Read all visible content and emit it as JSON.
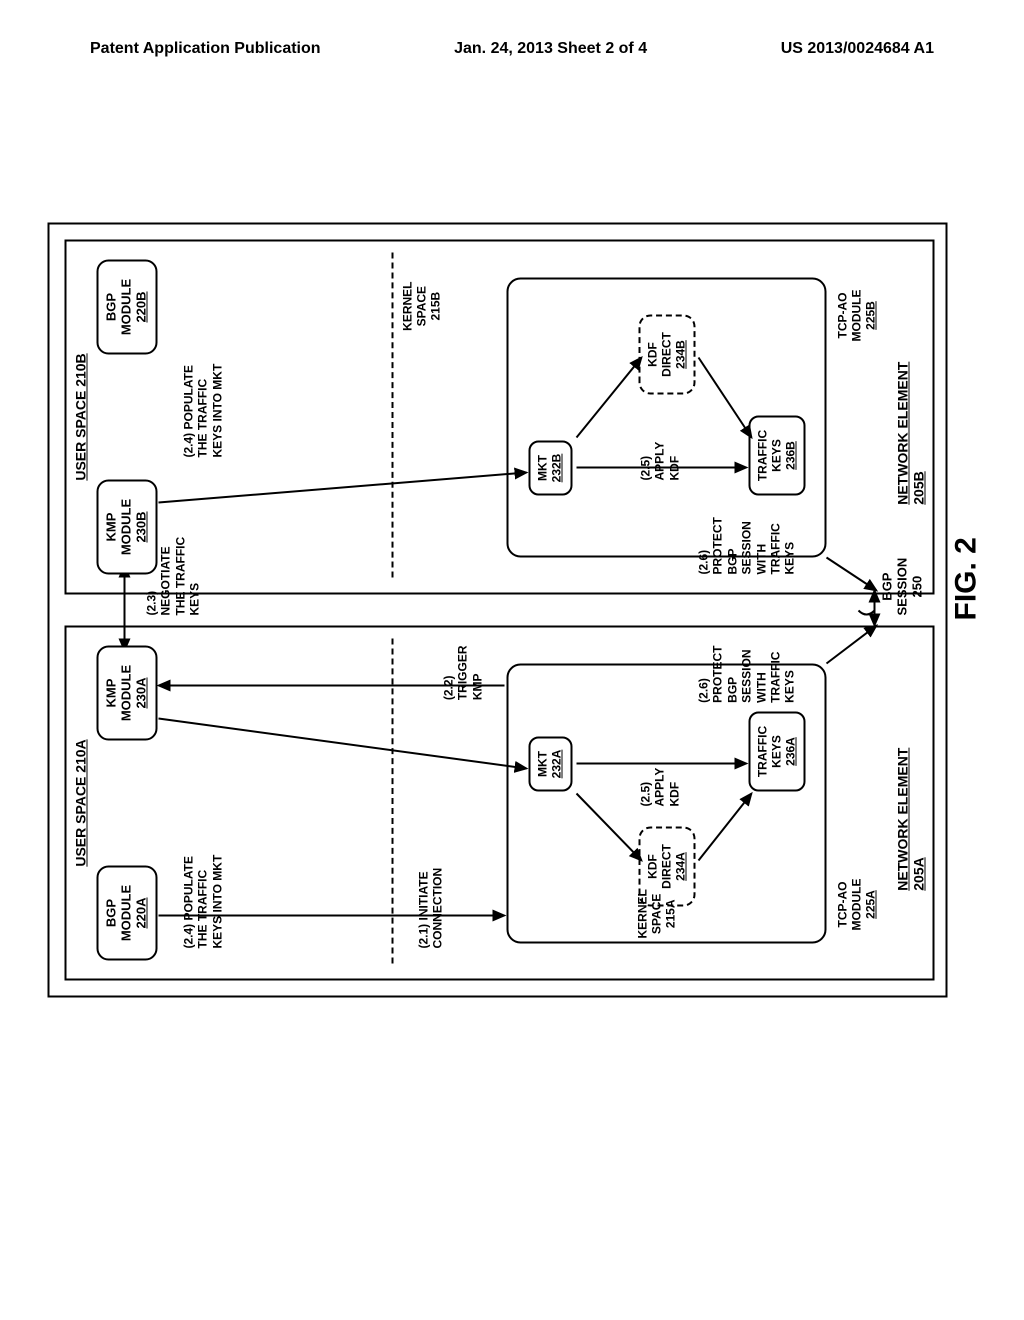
{
  "header": {
    "left": "Patent Application Publication",
    "center": "Jan. 24, 2013  Sheet 2 of 4",
    "right": "US 2013/0024684 A1"
  },
  "figure_caption": "FIG. 2",
  "elementA": {
    "label": "NETWORK ELEMENT 205A",
    "user_space": "USER SPACE 210A",
    "kernel": "KERNEL\nSPACE\n215A",
    "bgp": {
      "l1": "BGP",
      "l2": "MODULE",
      "id": "220A"
    },
    "kmp": {
      "l1": "KMP",
      "l2": "MODULE",
      "id": "230A"
    },
    "tcpao_lbl": {
      "l1": "TCP-AO",
      "l2": "MODULE",
      "id": "225A"
    },
    "mkt": {
      "l1": "MKT",
      "id": "232A"
    },
    "tk": {
      "l1": "TRAFFIC",
      "l2": "KEYS",
      "id": "236A"
    },
    "kdf": {
      "l1": "KDF",
      "l2": "DIRECT",
      "id": "234A"
    }
  },
  "elementB": {
    "label": "NETWORK ELEMENT 205B",
    "user_space": "USER SPACE 210B",
    "kernel": "KERNEL\nSPACE\n215B",
    "bgp": {
      "l1": "BGP",
      "l2": "MODULE",
      "id": "220B"
    },
    "kmp": {
      "l1": "KMP",
      "l2": "MODULE",
      "id": "230B"
    },
    "tcpao_lbl": {
      "l1": "TCP-AO",
      "l2": "MODULE",
      "id": "225B"
    },
    "mkt": {
      "l1": "MKT",
      "id": "232B"
    },
    "tk": {
      "l1": "TRAFFIC",
      "l2": "KEYS",
      "id": "236B"
    },
    "kdf": {
      "l1": "KDF",
      "l2": "DIRECT",
      "id": "234B"
    }
  },
  "notes": {
    "n21": "(2.1) INITIATE\nCONNECTION",
    "n22": "(2.2)\nTRIGGER\nKMP",
    "n23": "(2.3)\nNEGOTIATE\nTHE TRAFFIC\nKEYS",
    "n24a": "(2.4) POPULATE\nTHE TRAFFIC\nKEYS INTO MKT",
    "n24b": "(2.4) POPULATE\nTHE TRAFFIC\nKEYS INTO MKT",
    "n25a": "(2.5)\nAPPLY\nKDF",
    "n25b": "(2.5)\nAPPLY\nKDF",
    "n26a": "(2.6)\nPROTECT\nBGP\nSESSION\nWITH\nTRAFFIC\nKEYS",
    "n26b": "(2.6)\nPROTECT\nBGP\nSESSION\nWITH\nTRAFFIC\nKEYS",
    "bgp_session": "BGP\nSESSION\n250"
  }
}
